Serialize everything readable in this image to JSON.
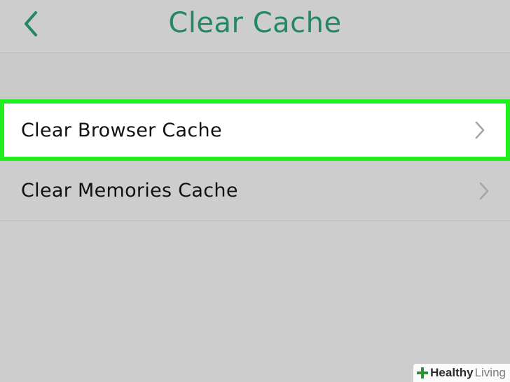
{
  "header": {
    "title": "Clear Cache",
    "back_icon": "chevron-left-icon",
    "accent_color": "#23876a"
  },
  "list": {
    "items": [
      {
        "label": "Clear Browser Cache",
        "icon": "chevron-right-icon",
        "highlighted": true
      },
      {
        "label": "Clear Memories Cache",
        "icon": "chevron-right-icon",
        "highlighted": false
      }
    ],
    "highlight_color": "#22f01e"
  },
  "watermark": {
    "bold": "Healthy",
    "light": "Living",
    "icon": "cross-logo-icon"
  }
}
